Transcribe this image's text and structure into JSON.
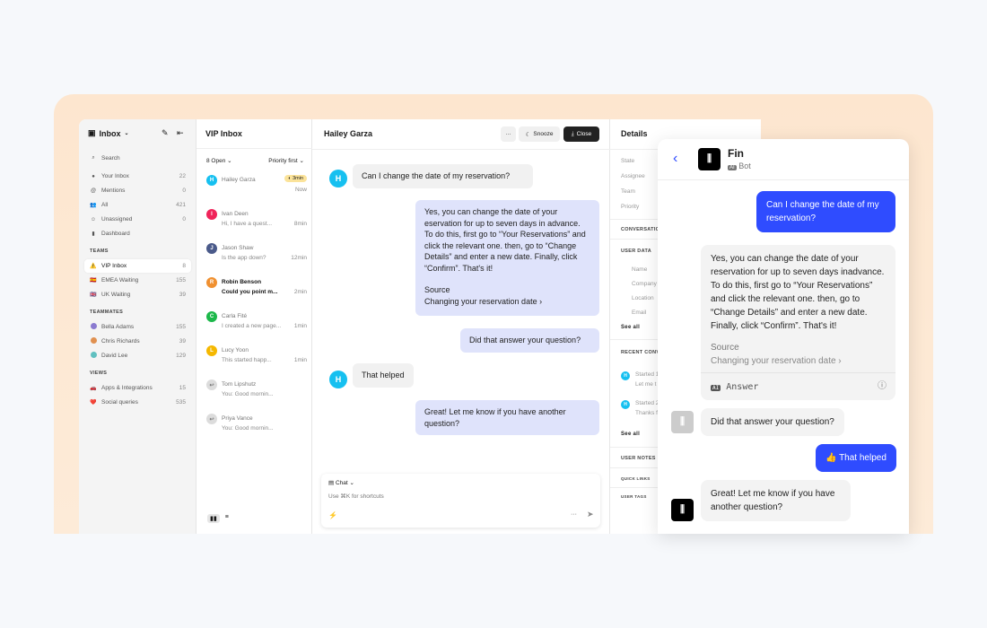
{
  "sidebar": {
    "title": "Inbox",
    "search": "Search",
    "items": [
      {
        "icon": "avatar",
        "label": "Your Inbox",
        "count": "22"
      },
      {
        "icon": "at-icon",
        "label": "Mentions",
        "count": "0"
      },
      {
        "icon": "people-icon",
        "label": "All",
        "count": "421"
      },
      {
        "icon": "unassigned-icon",
        "label": "Unassigned",
        "count": "0"
      },
      {
        "icon": "chart-icon",
        "label": "Dashboard",
        "count": ""
      }
    ],
    "teams_label": "TEAMS",
    "teams": [
      {
        "icon": "⚠️",
        "label": "VIP Inbox",
        "count": "8"
      },
      {
        "icon": "🇪🇸",
        "label": "EMEA Waiting",
        "count": "155"
      },
      {
        "icon": "🇬🇧",
        "label": "UK Waiting",
        "count": "39"
      }
    ],
    "teammates_label": "TEAMMATES",
    "teammates": [
      {
        "label": "Bella Adams",
        "count": "155"
      },
      {
        "label": "Chris Richards",
        "count": "39"
      },
      {
        "label": "David Lee",
        "count": "129"
      }
    ],
    "views_label": "VIEWS",
    "views": [
      {
        "icon": "🚗",
        "label": "Apps & Integrations",
        "count": "15"
      },
      {
        "icon": "❤️",
        "label": "Social queries",
        "count": "535"
      }
    ]
  },
  "list": {
    "title": "VIP Inbox",
    "filter_open": "8 Open",
    "sort": "Priority first",
    "conversations": [
      {
        "initial": "H",
        "color": "#16c0f0",
        "name": "Hailey Garza",
        "preview": "",
        "time": "Now",
        "badge": "3min"
      },
      {
        "initial": "I",
        "color": "#f0245a",
        "name": "Ivan Deen",
        "preview": "Hi, I have a quest...",
        "time": "8min"
      },
      {
        "initial": "J",
        "color": "#4a5a8a",
        "name": "Jason Shaw",
        "preview": "Is the app down?",
        "time": "12min"
      },
      {
        "initial": "R",
        "color": "#f09030",
        "name": "Robin Benson",
        "preview": "Could you point m...",
        "time": "2min",
        "bold": true
      },
      {
        "initial": "C",
        "color": "#1cb84a",
        "name": "Carla Fité",
        "preview": "I created a new page...",
        "time": "1min"
      },
      {
        "initial": "L",
        "color": "#f5b800",
        "name": "Lucy Yoon",
        "preview": "This started happ...",
        "time": "1min"
      },
      {
        "initial": "↩",
        "color": "#dcdcdc",
        "name": "Tom Lipshutz",
        "preview": "You: Good mornin...",
        "time": ""
      },
      {
        "initial": "↩",
        "color": "#dcdcdc",
        "name": "Priya Vance",
        "preview": "You: Good mornin...",
        "time": ""
      }
    ]
  },
  "conversation": {
    "title": "Hailey Garza",
    "more": "···",
    "snooze": "Snooze",
    "close": "Close",
    "avatar_initial": "H",
    "messages": {
      "q1": "Can I change the date of my reservation?",
      "a1": "Yes, you can change the date of your eservation for up to seven days in advance. To do this, first go to “Your Reservations” and click the relevant one. then, go to “Change Details” and enter a new date. Finally, click “Confirm”. That's it!",
      "a1_source_label": "Source",
      "a1_source_link": "Changing your reservation date",
      "a2": "Did that answer your question?",
      "q2": "That helped",
      "a3": "Great! Let me know if you have another question?"
    },
    "composer": {
      "channel": "Chat",
      "placeholder": "Use ⌘K for shortcuts",
      "more": "···"
    }
  },
  "details": {
    "title": "Details",
    "fields": [
      "State",
      "Assignee",
      "Team",
      "Priority"
    ],
    "conversation_label": "CONVERSATION",
    "user_data_label": "USER DATA",
    "user_fields": [
      "Name",
      "Company",
      "Location",
      "Email"
    ],
    "see_all": "See all",
    "recent_label": "RECENT CONV",
    "recent": [
      {
        "title": "Started 1",
        "preview": "Let me t"
      },
      {
        "title": "Started 2",
        "preview": "Thanks f"
      }
    ],
    "user_notes": "USER NOTES",
    "quick_links": "QUICK LINKS",
    "user_tags": "USER TAGS"
  },
  "fin": {
    "name": "Fin",
    "ai_badge": "AI",
    "role": "Bot",
    "q1": "Can I change the date of my reservation?",
    "a1": "Yes, you can change the date of your reservation for up to seven days inadvance. To do this, first go to “Your Reservations” and click the relevant one. then, go to “Change Details” and enter a new date. Finally, click “Confirm”. That's it!",
    "source_label": "Source",
    "source_link": "Changing your reservation date",
    "answer_label": "Answer",
    "a2": "Did that answer your question?",
    "q2": "That helped",
    "a3": "Great! Let me know if you have another question?",
    "accent": "#2f4cff"
  }
}
